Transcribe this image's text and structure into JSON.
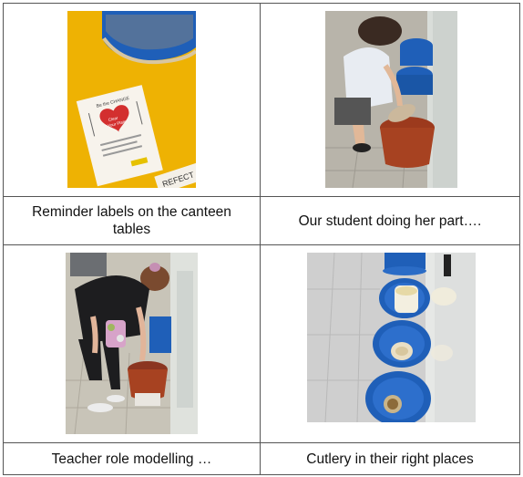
{
  "table": {
    "captions": [
      "Reminder labels on the canteen tables",
      "Our student doing her part….",
      "Teacher role modelling …",
      "Cutlery in their right places"
    ],
    "card_text": {
      "line1": "Be the CHANGE",
      "heart_line1": "Clear",
      "heart_line2": "Your Plate",
      "sign_text": "REFECT"
    }
  },
  "colors": {
    "table_yellow": "#f2b705",
    "basin_blue": "#1f5fb8",
    "border": "#555555"
  }
}
